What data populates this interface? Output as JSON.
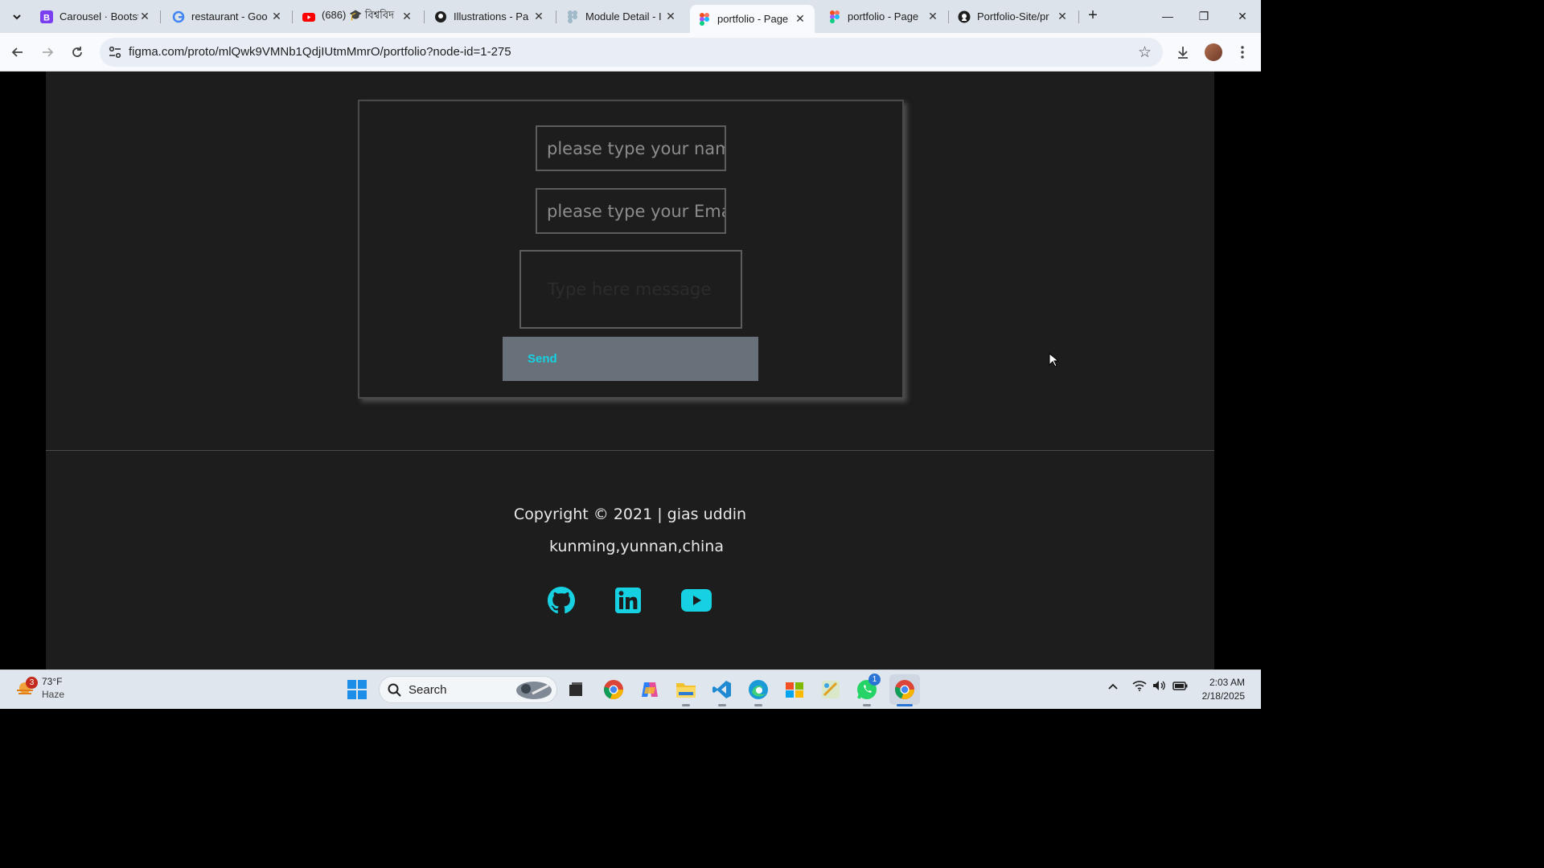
{
  "browser": {
    "tabs": [
      {
        "title": "Carousel · Bootst",
        "icon": "bootstrap-icon",
        "active": false
      },
      {
        "title": "restaurant - Goo",
        "icon": "google-icon",
        "active": false
      },
      {
        "title": "(686) 🎓 বিশ্ববিদ",
        "icon": "youtube-icon",
        "active": false
      },
      {
        "title": "Illustrations - Pa",
        "icon": "github-icon",
        "active": false
      },
      {
        "title": "Module Detail - I",
        "icon": "figma-icon",
        "active": false
      },
      {
        "title": "portfolio - Page",
        "icon": "figma-icon",
        "active": true
      },
      {
        "title": "portfolio - Page",
        "icon": "figma-icon",
        "active": false
      },
      {
        "title": "Portfolio-Site/pr",
        "icon": "github-icon",
        "active": false
      }
    ],
    "url": "figma.com/proto/mlQwk9VMNb1QdjIUtmMmrO/portfolio?node-id=1-275"
  },
  "contact_form": {
    "name_placeholder": "please type your name",
    "email_placeholder": "please type your Email",
    "message_placeholder": "Type here message",
    "send_label": "Send"
  },
  "footer": {
    "copyright": "Copyright © 2021 | gias uddin",
    "location": "kunming,yunnan,china",
    "socials": [
      "github-icon",
      "linkedin-icon",
      "youtube-icon"
    ],
    "accent_color": "#15d1e1"
  },
  "taskbar": {
    "weather_temp": "73°F",
    "weather_desc": "Haze",
    "weather_badge": "3",
    "search_label": "Search",
    "time": "2:03 AM",
    "date": "2/18/2025",
    "whatsapp_badge": "1"
  }
}
